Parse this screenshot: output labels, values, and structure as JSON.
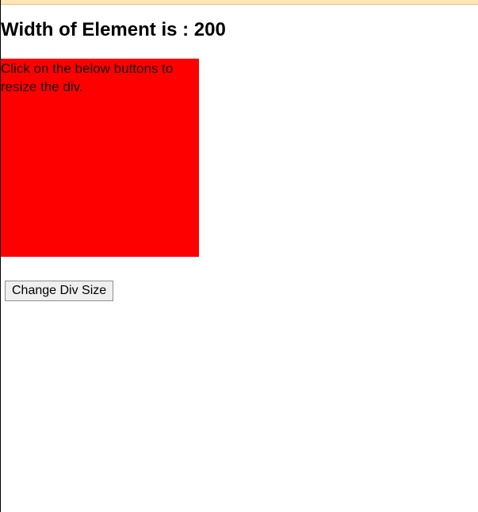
{
  "header": {
    "width_label_prefix": "Width of Element is : ",
    "width_value": "200"
  },
  "box": {
    "text": "Click on the below buttons to resize the div.",
    "background": "#ff0000"
  },
  "controls": {
    "change_button_label": "Change Div Size"
  }
}
